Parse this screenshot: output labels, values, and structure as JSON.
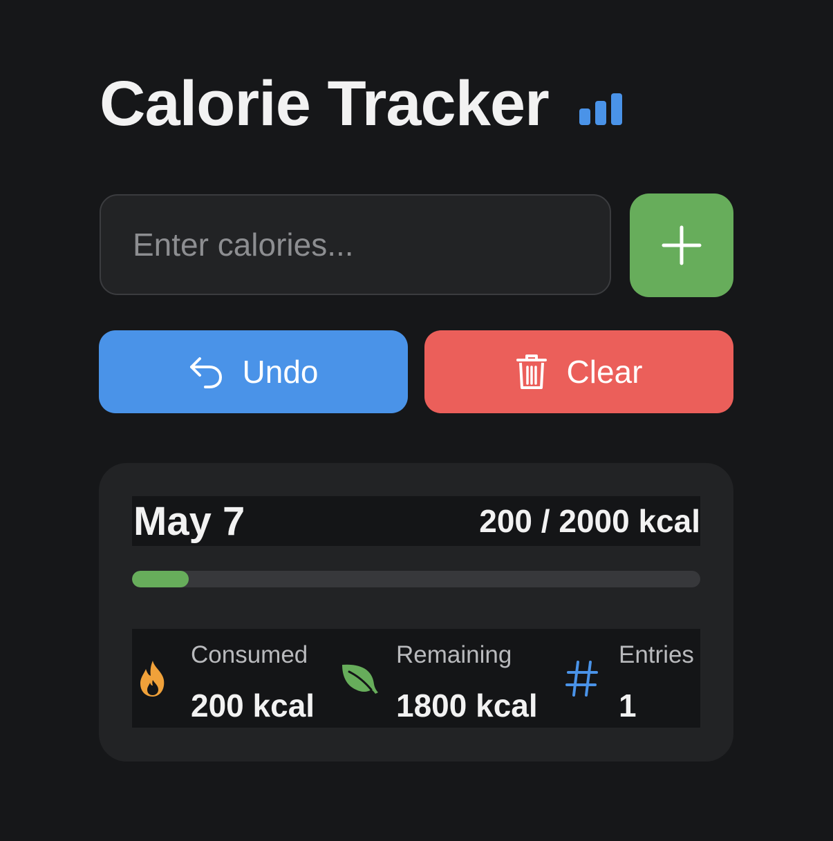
{
  "header": {
    "title": "Calorie Tracker",
    "icon": "bar-chart-icon",
    "icon_color": "#4a93e8"
  },
  "entry": {
    "placeholder": "Enter calories...",
    "value": "",
    "add_icon": "plus-icon"
  },
  "actions": {
    "undo_label": "Undo",
    "undo_icon": "undo-arrow-icon",
    "clear_label": "Clear",
    "clear_icon": "trash-icon"
  },
  "day": {
    "date": "May 7",
    "total": "200 / 2000 kcal",
    "progress_fraction": 0.1
  },
  "stats": [
    {
      "label": "Consumed",
      "value": "200 kcal",
      "icon": "fire-icon",
      "color": "#f0a13a"
    },
    {
      "label": "Remaining",
      "value": "1800 kcal",
      "icon": "leaf-icon",
      "color": "#67ad5b"
    },
    {
      "label": "Entries",
      "value": "1",
      "icon": "hash-icon",
      "color": "#4a93e8"
    }
  ],
  "colors": {
    "background": "#161719",
    "card": "#222325",
    "add": "#67ad5b",
    "undo": "#4a93e8",
    "clear": "#eb5f5a"
  }
}
